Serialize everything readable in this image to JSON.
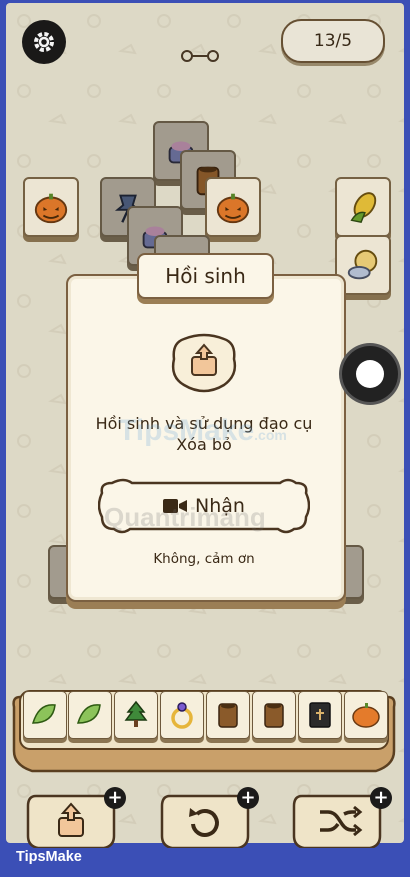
{
  "game": {
    "level_counter": "13/5",
    "settings_icon": "gear-icon",
    "progress_icon": "dumbbell-progress-icon"
  },
  "board": {
    "tiles": [
      "pumpkin",
      "pot",
      "barrel",
      "pin",
      "pot",
      "pumpkin",
      "corn",
      "moon-cloud",
      "pot"
    ]
  },
  "dialog": {
    "title": "Hồi sinh",
    "message_line1": "Hồi sinh và sử dụng đạo cụ",
    "message_line2": "Xóa bỏ",
    "icon": "tile-remove-icon",
    "receive_label": "Nhận",
    "receive_icon": "video-camera-icon",
    "decline_label": "Không, cảm ơn"
  },
  "tray": {
    "items": [
      "lettuce",
      "lettuce",
      "tree",
      "ring",
      "barrel",
      "barrel",
      "book",
      "pumpkin"
    ]
  },
  "tools": [
    {
      "icon": "undo-up-icon"
    },
    {
      "icon": "refresh-icon"
    },
    {
      "icon": "shuffle-icon"
    }
  ],
  "watermarks": {
    "tipsmake": "TipsMake",
    "tipsmake_suffix": ".com",
    "quantrimang": "Quantrimang"
  },
  "brand": "TipsMake",
  "colors": {
    "frame": "#3b4fb6",
    "background": "#e7e2cf",
    "tile": "#f6efdc",
    "outline": "#7a6546"
  }
}
